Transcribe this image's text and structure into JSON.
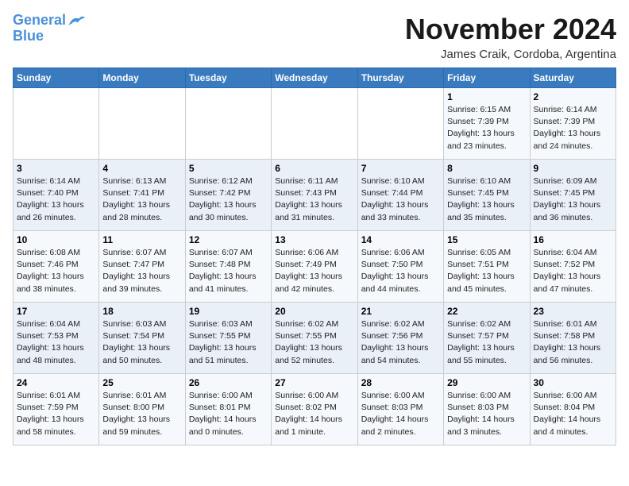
{
  "header": {
    "logo_line1": "General",
    "logo_line2": "Blue",
    "month": "November 2024",
    "location": "James Craik, Cordoba, Argentina"
  },
  "weekdays": [
    "Sunday",
    "Monday",
    "Tuesday",
    "Wednesday",
    "Thursday",
    "Friday",
    "Saturday"
  ],
  "weeks": [
    [
      {
        "day": "",
        "info": ""
      },
      {
        "day": "",
        "info": ""
      },
      {
        "day": "",
        "info": ""
      },
      {
        "day": "",
        "info": ""
      },
      {
        "day": "",
        "info": ""
      },
      {
        "day": "1",
        "info": "Sunrise: 6:15 AM\nSunset: 7:39 PM\nDaylight: 13 hours\nand 23 minutes."
      },
      {
        "day": "2",
        "info": "Sunrise: 6:14 AM\nSunset: 7:39 PM\nDaylight: 13 hours\nand 24 minutes."
      }
    ],
    [
      {
        "day": "3",
        "info": "Sunrise: 6:14 AM\nSunset: 7:40 PM\nDaylight: 13 hours\nand 26 minutes."
      },
      {
        "day": "4",
        "info": "Sunrise: 6:13 AM\nSunset: 7:41 PM\nDaylight: 13 hours\nand 28 minutes."
      },
      {
        "day": "5",
        "info": "Sunrise: 6:12 AM\nSunset: 7:42 PM\nDaylight: 13 hours\nand 30 minutes."
      },
      {
        "day": "6",
        "info": "Sunrise: 6:11 AM\nSunset: 7:43 PM\nDaylight: 13 hours\nand 31 minutes."
      },
      {
        "day": "7",
        "info": "Sunrise: 6:10 AM\nSunset: 7:44 PM\nDaylight: 13 hours\nand 33 minutes."
      },
      {
        "day": "8",
        "info": "Sunrise: 6:10 AM\nSunset: 7:45 PM\nDaylight: 13 hours\nand 35 minutes."
      },
      {
        "day": "9",
        "info": "Sunrise: 6:09 AM\nSunset: 7:45 PM\nDaylight: 13 hours\nand 36 minutes."
      }
    ],
    [
      {
        "day": "10",
        "info": "Sunrise: 6:08 AM\nSunset: 7:46 PM\nDaylight: 13 hours\nand 38 minutes."
      },
      {
        "day": "11",
        "info": "Sunrise: 6:07 AM\nSunset: 7:47 PM\nDaylight: 13 hours\nand 39 minutes."
      },
      {
        "day": "12",
        "info": "Sunrise: 6:07 AM\nSunset: 7:48 PM\nDaylight: 13 hours\nand 41 minutes."
      },
      {
        "day": "13",
        "info": "Sunrise: 6:06 AM\nSunset: 7:49 PM\nDaylight: 13 hours\nand 42 minutes."
      },
      {
        "day": "14",
        "info": "Sunrise: 6:06 AM\nSunset: 7:50 PM\nDaylight: 13 hours\nand 44 minutes."
      },
      {
        "day": "15",
        "info": "Sunrise: 6:05 AM\nSunset: 7:51 PM\nDaylight: 13 hours\nand 45 minutes."
      },
      {
        "day": "16",
        "info": "Sunrise: 6:04 AM\nSunset: 7:52 PM\nDaylight: 13 hours\nand 47 minutes."
      }
    ],
    [
      {
        "day": "17",
        "info": "Sunrise: 6:04 AM\nSunset: 7:53 PM\nDaylight: 13 hours\nand 48 minutes."
      },
      {
        "day": "18",
        "info": "Sunrise: 6:03 AM\nSunset: 7:54 PM\nDaylight: 13 hours\nand 50 minutes."
      },
      {
        "day": "19",
        "info": "Sunrise: 6:03 AM\nSunset: 7:55 PM\nDaylight: 13 hours\nand 51 minutes."
      },
      {
        "day": "20",
        "info": "Sunrise: 6:02 AM\nSunset: 7:55 PM\nDaylight: 13 hours\nand 52 minutes."
      },
      {
        "day": "21",
        "info": "Sunrise: 6:02 AM\nSunset: 7:56 PM\nDaylight: 13 hours\nand 54 minutes."
      },
      {
        "day": "22",
        "info": "Sunrise: 6:02 AM\nSunset: 7:57 PM\nDaylight: 13 hours\nand 55 minutes."
      },
      {
        "day": "23",
        "info": "Sunrise: 6:01 AM\nSunset: 7:58 PM\nDaylight: 13 hours\nand 56 minutes."
      }
    ],
    [
      {
        "day": "24",
        "info": "Sunrise: 6:01 AM\nSunset: 7:59 PM\nDaylight: 13 hours\nand 58 minutes."
      },
      {
        "day": "25",
        "info": "Sunrise: 6:01 AM\nSunset: 8:00 PM\nDaylight: 13 hours\nand 59 minutes."
      },
      {
        "day": "26",
        "info": "Sunrise: 6:00 AM\nSunset: 8:01 PM\nDaylight: 14 hours\nand 0 minutes."
      },
      {
        "day": "27",
        "info": "Sunrise: 6:00 AM\nSunset: 8:02 PM\nDaylight: 14 hours\nand 1 minute."
      },
      {
        "day": "28",
        "info": "Sunrise: 6:00 AM\nSunset: 8:03 PM\nDaylight: 14 hours\nand 2 minutes."
      },
      {
        "day": "29",
        "info": "Sunrise: 6:00 AM\nSunset: 8:03 PM\nDaylight: 14 hours\nand 3 minutes."
      },
      {
        "day": "30",
        "info": "Sunrise: 6:00 AM\nSunset: 8:04 PM\nDaylight: 14 hours\nand 4 minutes."
      }
    ]
  ]
}
